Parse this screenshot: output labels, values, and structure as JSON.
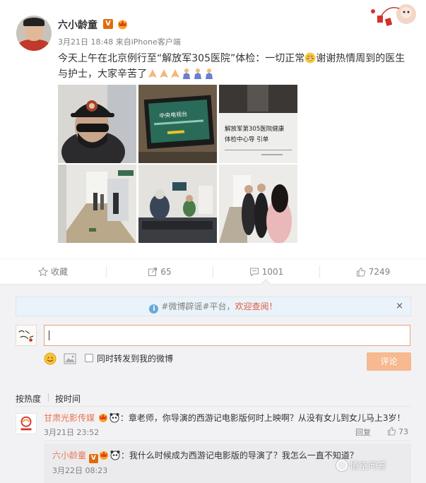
{
  "post": {
    "author": "六小龄童",
    "verified_badge": "V",
    "timestamp": "3月21日 18:48",
    "source_prefix": "来自",
    "source": "iPhone客户端",
    "text_part1": "今天上午在北京例行至“解放军305医院”体检：一切正常",
    "text_part2": "谢谢热情周到的医生与护士，大家辛苦了",
    "images": [
      {
        "alt": "戴帽子与口罩的人"
      },
      {
        "alt": "中央电视台 屏幕"
      },
      {
        "alt": "解放军第305医院健康体检中心导引单"
      },
      {
        "alt": "医院走廊"
      },
      {
        "alt": "候诊区"
      },
      {
        "alt": "排队的人群"
      }
    ],
    "photo_texts": {
      "cctv": "中央电视台",
      "sign_line1": "解放军第305医院健康",
      "sign_line2": "体检中心导 引单"
    }
  },
  "actions": {
    "favorite_label": "收藏",
    "repost_count": "65",
    "comment_count": "1001",
    "like_count": "7249"
  },
  "comments_panel": {
    "notice_prefix": "#微博辟谣#平台，",
    "notice_link": "欢迎查阅！",
    "notice_close": "×",
    "input_value": "",
    "repost_checkbox_label": "同时转发到我的微博",
    "submit_label": "评论",
    "sort_hot": "按热度",
    "sort_time": "按时间"
  },
  "comments": [
    {
      "author": "甘肃光影传媒",
      "text": "：章老师，你导演的西游记电影版何时上映啊？从没有女儿到女儿马上3岁！",
      "date": "3月21日 23:52",
      "reply_label": "回复",
      "likes": "73"
    }
  ],
  "reply": {
    "author": "六小龄童",
    "text": "：我什么时候成为西游记电影版的导演了？我怎么一直不知道？",
    "date": "3月22日 08:23"
  },
  "watermark": "悟空问答",
  "colors": {
    "accent_orange": "#eb7350",
    "verified": "#e06b0c",
    "muted": "#808080",
    "submit_bg": "#f7b98f"
  }
}
